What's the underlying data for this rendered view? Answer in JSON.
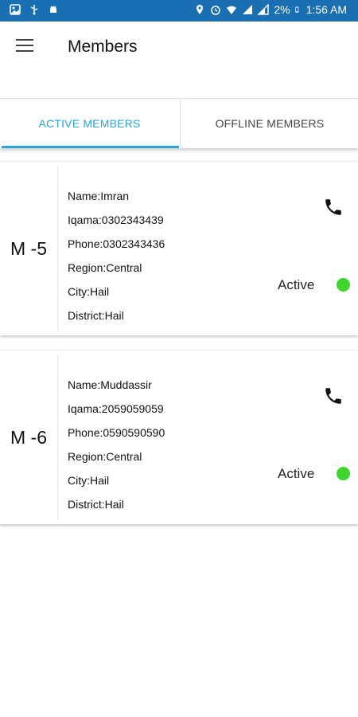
{
  "status_bar": {
    "battery": "2%",
    "time": "1:56 AM"
  },
  "header": {
    "title": "Members"
  },
  "tabs": [
    {
      "label": "ACTIVE MEMBERS",
      "selected": true
    },
    {
      "label": "OFFLINE MEMBERS",
      "selected": false
    }
  ],
  "members": [
    {
      "code": "M -5",
      "name": "Name:Imran",
      "iqama": "Iqama:0302343439",
      "phone": "Phone:0302343436",
      "region": "Region:Central",
      "city": "City:Hail",
      "district": "District:Hail",
      "status": "Active"
    },
    {
      "code": "M -6",
      "name": "Name:Muddassir",
      "iqama": "Iqama:2059059059",
      "phone": "Phone:0590590590",
      "region": "Region:Central",
      "city": "City:Hail",
      "district": "District:Hail",
      "status": "Active"
    }
  ],
  "colors": {
    "status_bar": "#1a6fb3",
    "accent": "#2aa3df",
    "active_dot": "#3cd62f"
  }
}
